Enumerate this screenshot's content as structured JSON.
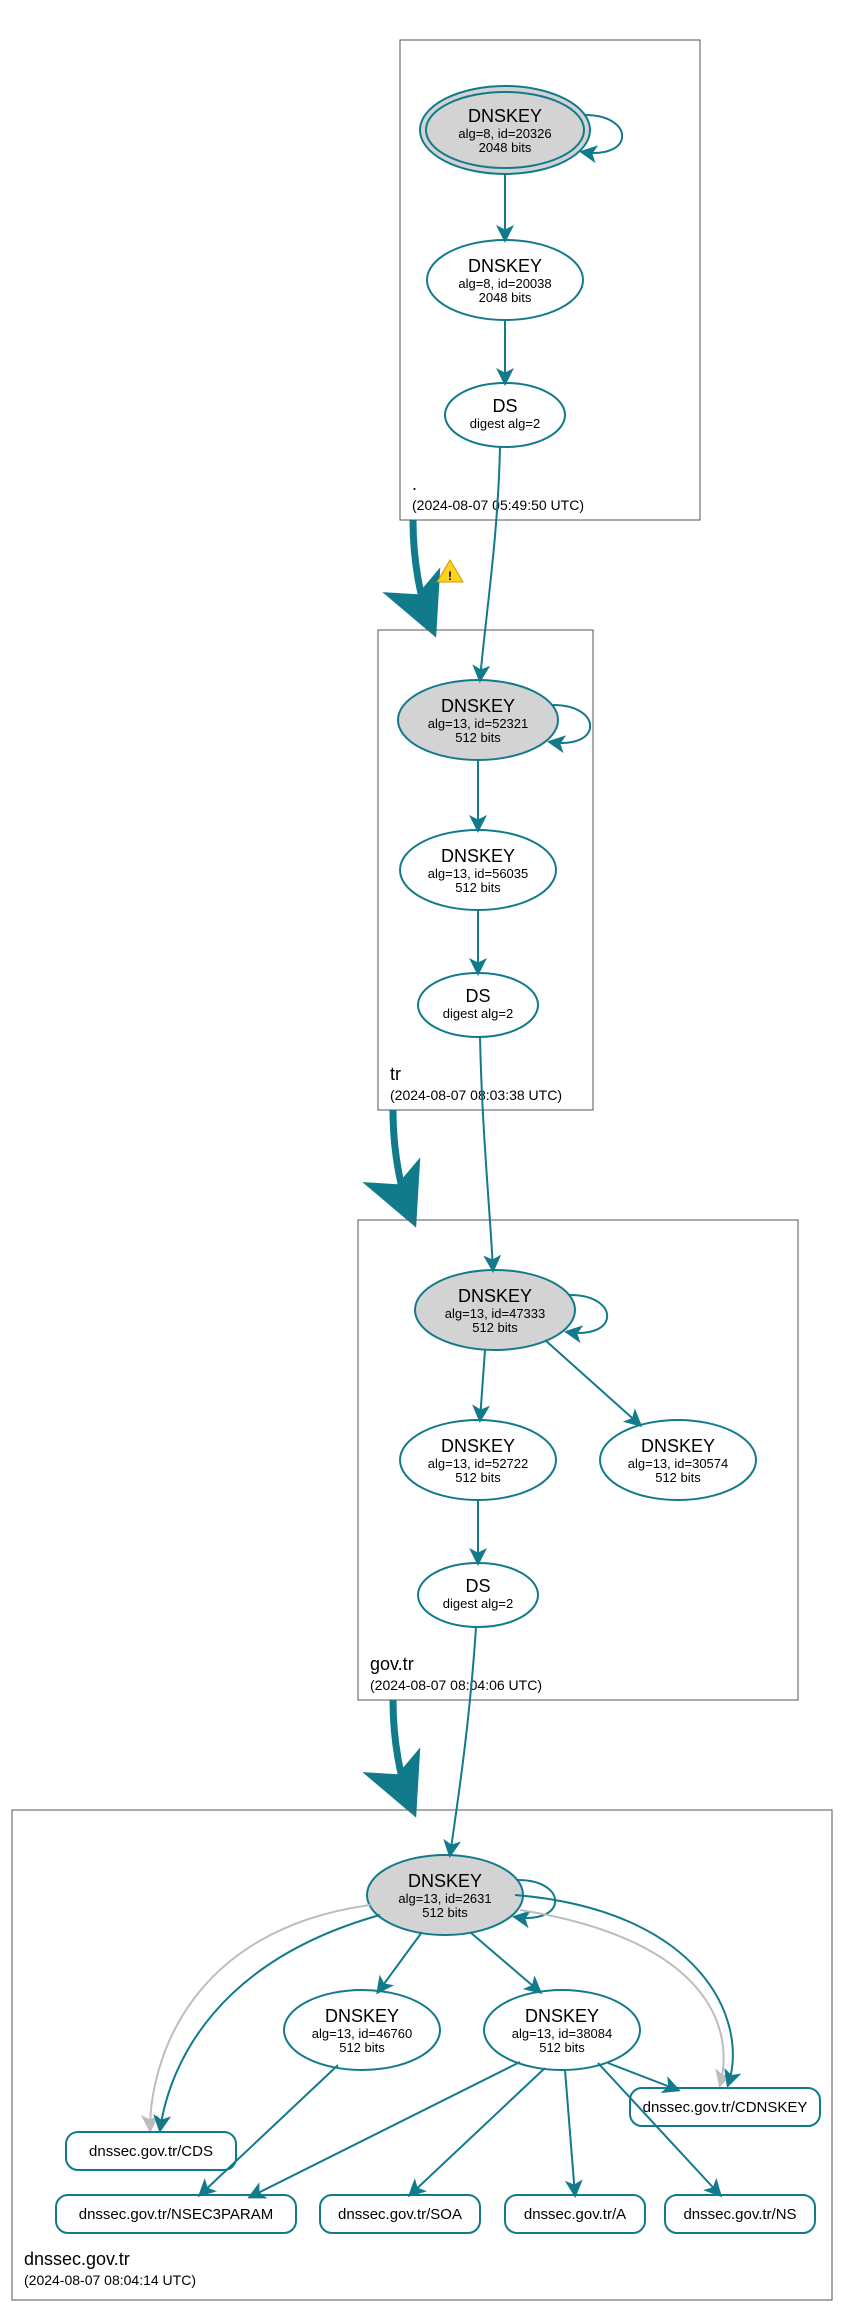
{
  "chart_data": {
    "type": "diagram",
    "title": "DNSSEC authentication chain",
    "tool": "DNSViz-style graph",
    "zones": [
      {
        "id": "root",
        "label": ".",
        "timestamp": "(2024-08-07 05:49:50 UTC)",
        "nodes": [
          {
            "id": "root_ksk",
            "kind": "ksk",
            "line1": "DNSKEY",
            "line2": "alg=8, id=20326",
            "line3": "2048 bits"
          },
          {
            "id": "root_zsk",
            "kind": "dnskey",
            "line1": "DNSKEY",
            "line2": "alg=8, id=20038",
            "line3": "2048 bits"
          },
          {
            "id": "root_ds",
            "kind": "ds",
            "line1": "DS",
            "line2": "digest alg=2"
          }
        ]
      },
      {
        "id": "tr",
        "label": "tr",
        "timestamp": "(2024-08-07 08:03:38 UTC)",
        "nodes": [
          {
            "id": "tr_ksk",
            "kind": "ksk",
            "line1": "DNSKEY",
            "line2": "alg=13, id=52321",
            "line3": "512 bits"
          },
          {
            "id": "tr_zsk",
            "kind": "dnskey",
            "line1": "DNSKEY",
            "line2": "alg=13, id=56035",
            "line3": "512 bits"
          },
          {
            "id": "tr_ds",
            "kind": "ds",
            "line1": "DS",
            "line2": "digest alg=2"
          }
        ]
      },
      {
        "id": "govtr",
        "label": "gov.tr",
        "timestamp": "(2024-08-07 08:04:06 UTC)",
        "nodes": [
          {
            "id": "gov_ksk",
            "kind": "ksk",
            "line1": "DNSKEY",
            "line2": "alg=13, id=47333",
            "line3": "512 bits"
          },
          {
            "id": "gov_zsk",
            "kind": "dnskey",
            "line1": "DNSKEY",
            "line2": "alg=13, id=52722",
            "line3": "512 bits"
          },
          {
            "id": "gov_extra",
            "kind": "dnskey",
            "line1": "DNSKEY",
            "line2": "alg=13, id=30574",
            "line3": "512 bits"
          },
          {
            "id": "gov_ds",
            "kind": "ds",
            "line1": "DS",
            "line2": "digest alg=2"
          }
        ]
      },
      {
        "id": "dnssecgovtr",
        "label": "dnssec.gov.tr",
        "timestamp": "(2024-08-07 08:04:14 UTC)",
        "nodes": [
          {
            "id": "d_ksk",
            "kind": "ksk",
            "line1": "DNSKEY",
            "line2": "alg=13, id=2631",
            "line3": "512 bits"
          },
          {
            "id": "d_zsk1",
            "kind": "dnskey",
            "line1": "DNSKEY",
            "line2": "alg=13, id=46760",
            "line3": "512 bits"
          },
          {
            "id": "d_zsk2",
            "kind": "dnskey",
            "line1": "DNSKEY",
            "line2": "alg=13, id=38084",
            "line3": "512 bits"
          },
          {
            "id": "rr_cdnskey",
            "kind": "rr",
            "label": "dnssec.gov.tr/CDNSKEY"
          },
          {
            "id": "rr_cds",
            "kind": "rr",
            "label": "dnssec.gov.tr/CDS"
          },
          {
            "id": "rr_nsec3",
            "kind": "rr",
            "label": "dnssec.gov.tr/NSEC3PARAM"
          },
          {
            "id": "rr_soa",
            "kind": "rr",
            "label": "dnssec.gov.tr/SOA"
          },
          {
            "id": "rr_a",
            "kind": "rr",
            "label": "dnssec.gov.tr/A"
          },
          {
            "id": "rr_ns",
            "kind": "rr",
            "label": "dnssec.gov.tr/NS"
          }
        ]
      }
    ],
    "edges": [
      {
        "from": "root_ksk",
        "to": "root_ksk",
        "self": true
      },
      {
        "from": "root_ksk",
        "to": "root_zsk"
      },
      {
        "from": "root_zsk",
        "to": "root_ds"
      },
      {
        "from": "root_ds",
        "to": "tr_ksk"
      },
      {
        "from": "root",
        "to": "tr",
        "delegation": true,
        "warning": true
      },
      {
        "from": "tr_ksk",
        "to": "tr_ksk",
        "self": true
      },
      {
        "from": "tr_ksk",
        "to": "tr_zsk"
      },
      {
        "from": "tr_zsk",
        "to": "tr_ds"
      },
      {
        "from": "tr_ds",
        "to": "gov_ksk"
      },
      {
        "from": "tr",
        "to": "govtr",
        "delegation": true
      },
      {
        "from": "gov_ksk",
        "to": "gov_ksk",
        "self": true
      },
      {
        "from": "gov_ksk",
        "to": "gov_zsk"
      },
      {
        "from": "gov_ksk",
        "to": "gov_extra"
      },
      {
        "from": "gov_zsk",
        "to": "gov_ds"
      },
      {
        "from": "gov_ds",
        "to": "d_ksk"
      },
      {
        "from": "govtr",
        "to": "dnssecgovtr",
        "delegation": true
      },
      {
        "from": "d_ksk",
        "to": "d_ksk",
        "self": true
      },
      {
        "from": "d_ksk",
        "to": "d_zsk1"
      },
      {
        "from": "d_ksk",
        "to": "d_zsk2"
      },
      {
        "from": "d_ksk",
        "to": "rr_cdnskey"
      },
      {
        "from": "d_ksk",
        "to": "rr_cds"
      },
      {
        "from": "d_ksk",
        "to": "rr_cdnskey",
        "gray": true
      },
      {
        "from": "d_ksk",
        "to": "rr_cds",
        "gray": true
      },
      {
        "from": "d_zsk1",
        "to": "rr_nsec3"
      },
      {
        "from": "d_zsk2",
        "to": "rr_nsec3"
      },
      {
        "from": "d_zsk2",
        "to": "rr_soa"
      },
      {
        "from": "d_zsk2",
        "to": "rr_a"
      },
      {
        "from": "d_zsk2",
        "to": "rr_ns"
      },
      {
        "from": "d_zsk2",
        "to": "rr_cdnskey"
      }
    ]
  }
}
